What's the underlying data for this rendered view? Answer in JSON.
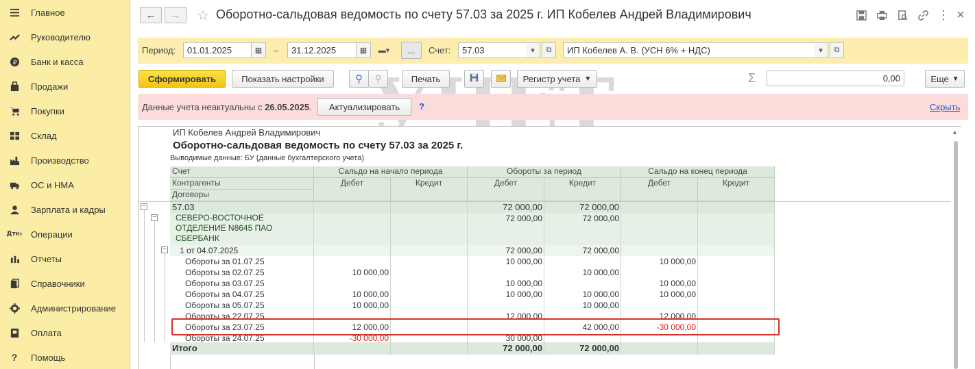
{
  "sidebar": {
    "items": [
      {
        "label": "Главное",
        "icon": "menu-icon"
      },
      {
        "label": "Руководителю",
        "icon": "trend-icon"
      },
      {
        "label": "Банк и касса",
        "icon": "ruble-icon"
      },
      {
        "label": "Продажи",
        "icon": "bag-icon"
      },
      {
        "label": "Покупки",
        "icon": "cart-icon"
      },
      {
        "label": "Склад",
        "icon": "warehouse-icon"
      },
      {
        "label": "Производство",
        "icon": "factory-icon"
      },
      {
        "label": "ОС и НМА",
        "icon": "truck-icon"
      },
      {
        "label": "Зарплата и кадры",
        "icon": "person-icon"
      },
      {
        "label": "Операции",
        "icon": "dt-kt-icon"
      },
      {
        "label": "Отчеты",
        "icon": "bar-chart-icon"
      },
      {
        "label": "Справочники",
        "icon": "books-icon"
      },
      {
        "label": "Администрирование",
        "icon": "gear-icon"
      },
      {
        "label": "Оплата",
        "icon": "payment-icon"
      },
      {
        "label": "Помощь",
        "icon": "question-icon"
      }
    ]
  },
  "header": {
    "back": "←",
    "forward": "→",
    "star": "☆",
    "title": "Оборотно-сальдовая ведомость по счету 57.03 за 2025 г. ИП Кобелев Андрей Владимирович",
    "more": "⋮",
    "close": "×"
  },
  "params": {
    "period_label": "Период:",
    "date_from": "01.01.2025",
    "dash": "–",
    "date_to": "31.12.2025",
    "ellipsis": "...",
    "account_label": "Счет:",
    "account": "57.03",
    "org": "ИП Кобелев А. В. (УСН 6% + НДС)"
  },
  "toolbar": {
    "generate": "Сформировать",
    "show_settings": "Показать настройки",
    "print": "Печать",
    "register": "Регистр учета",
    "sigma": "Σ",
    "sum_value": "0,00",
    "more": "Еще"
  },
  "alert": {
    "text_prefix": "Данные учета неактуальны с ",
    "date": "26.05.2025",
    "dot": ".",
    "update": "Актуализировать",
    "help": "?",
    "hide": "Скрыть"
  },
  "report": {
    "org": "ИП Кобелев Андрей Владимирович",
    "title": "Оборотно-сальдовая ведомость по счету 57.03 за 2025 г.",
    "output_data": "Выводимые данные:  БУ (данные бухгалтерского учета)",
    "headers": {
      "col1": [
        "Счет",
        "Контрагенты",
        "Договоры"
      ],
      "opening": "Сальдо на начало периода",
      "turnover": "Обороты за период",
      "closing": "Сальдо на конец периода",
      "debit": "Дебет",
      "credit": "Кредит"
    },
    "rows": [
      {
        "name": "57.03",
        "od": "",
        "oc": "",
        "td": "72 000,00",
        "tc": "72 000,00",
        "cd": "",
        "cc": ""
      },
      {
        "name": "СЕВЕРО-ВОСТОЧНОЕ",
        "name2": "ОТДЕЛЕНИЕ N8645 ПАО",
        "name3": "СБЕРБАНК",
        "od": "",
        "oc": "",
        "td": "72 000,00",
        "tc": "72 000,00",
        "cd": "",
        "cc": ""
      },
      {
        "name": "1 от 04.07.2025",
        "od": "",
        "oc": "",
        "td": "72 000,00",
        "tc": "72 000,00",
        "cd": "",
        "cc": ""
      },
      {
        "name": "Обороты за 01.07.25",
        "od": "",
        "oc": "",
        "td": "10 000,00",
        "tc": "",
        "cd": "10 000,00",
        "cc": ""
      },
      {
        "name": "Обороты за 02.07.25",
        "od": "10 000,00",
        "oc": "",
        "td": "",
        "tc": "10 000,00",
        "cd": "",
        "cc": ""
      },
      {
        "name": "Обороты за 03.07.25",
        "od": "",
        "oc": "",
        "td": "10 000,00",
        "tc": "",
        "cd": "10 000,00",
        "cc": ""
      },
      {
        "name": "Обороты за 04.07.25",
        "od": "10 000,00",
        "oc": "",
        "td": "10 000,00",
        "tc": "10 000,00",
        "cd": "10 000,00",
        "cc": ""
      },
      {
        "name": "Обороты за 05.07.25",
        "od": "10 000,00",
        "oc": "",
        "td": "",
        "tc": "10 000,00",
        "cd": "",
        "cc": ""
      },
      {
        "name": "Обороты за 22.07.25",
        "od": "",
        "oc": "",
        "td": "12 000,00",
        "tc": "",
        "cd": "12 000,00",
        "cc": ""
      },
      {
        "name": "Обороты за 23.07.25",
        "od": "12 000,00",
        "oc": "",
        "td": "",
        "tc": "42 000,00",
        "cd": "-30 000,00",
        "cc": ""
      },
      {
        "name": "Обороты за 24.07.25",
        "od": "-30 000,00",
        "oc": "",
        "td": "30 000,00",
        "tc": "",
        "cd": "",
        "cc": ""
      },
      {
        "name": "Итого",
        "od": "",
        "oc": "",
        "td": "72 000,00",
        "tc": "72 000,00",
        "cd": "",
        "cc": ""
      }
    ]
  },
  "watermark": {
    "line1": "УЧЕТ",
    "line2": "БЕЗ ЗАБОТ"
  },
  "colors": {
    "sidebar": "#fbeda5",
    "panel": "#fdeeb0",
    "alert": "#fbdcdb",
    "table_header": "#dde9dd",
    "highlight": "#d9302b",
    "negative": "#e01818"
  }
}
